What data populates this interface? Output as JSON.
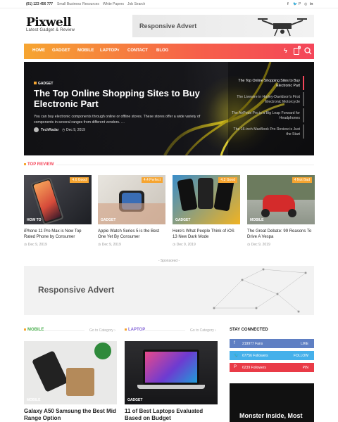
{
  "topbar": {
    "phone": "(01) 123 456 777",
    "links": [
      "Small Business",
      "Resources",
      "White Papers",
      "Job Search"
    ],
    "social_icons": [
      "facebook-icon",
      "twitter-icon",
      "pinterest-icon",
      "instagram-icon",
      "linkedin-icon"
    ]
  },
  "logo": {
    "name": "Pixwell",
    "tagline": "Latest Gadget & Review"
  },
  "advert_top": {
    "label": "Responsive Advert"
  },
  "nav": {
    "items": [
      "HOME",
      "GADGET",
      "MOBILE",
      "LAPTOP",
      "CONTACT",
      "BLOG"
    ],
    "laptop_chevron": "˅",
    "icons": [
      "lightning-icon",
      "bookmark-icon",
      "search-icon"
    ],
    "bookmark_count": "0"
  },
  "hero": {
    "category": "GADGET",
    "title": "The Top Online Shopping Sites to Buy Electronic Part",
    "description": "You can buy electronic components through online or offline stores. These stores offer a wide variety of components in several ranges from different vendors. …",
    "author": "TechRadar",
    "date": "Dec 9, 2019",
    "side_list": [
      "The Top Online Shopping Sites to Buy Electronic Part",
      "The Livewire in Harley-Davidson's First Electronic Motorcycle",
      "The AirPods Pro is a Big Leap Forward for Headphones",
      "The 16-inch MacBook Pro Review is Just the Start"
    ]
  },
  "top_review": {
    "title": "TOP REVIEW",
    "cards": [
      {
        "badge": "4.6 Good",
        "category": "HOW TO",
        "title": "iPhone 11 Pro Max is Now Top Rated Phone by Consumer",
        "date": "Dec 9, 2019"
      },
      {
        "badge": "4.4 Perfect",
        "category": "GADGET",
        "title": "Apple Watch Series 5 is the Best One Yet By Consumer",
        "date": "Dec 9, 2019"
      },
      {
        "badge": "4.2 Good",
        "category": "GADGET",
        "title": "Here's What People Think of iOS 13 New Dark Mode",
        "date": "Dec 9, 2019"
      },
      {
        "badge": "4 Not Bad",
        "category": "MOBILE",
        "title": "The Great Debate: 99 Reasons To Drive A Vespa",
        "date": "Dec 9, 2019"
      }
    ]
  },
  "sponsored_label": "- Sponsored -",
  "advert_mid": {
    "label": "Responsive Advert"
  },
  "mobile_block": {
    "title": "MOBILE",
    "goto": "Go to Category",
    "category": "MOBILE",
    "post_title": "Galaxy A50 Samsung the Best Mid Range Option"
  },
  "laptop_block": {
    "title": "LAPTOP",
    "goto": "Go to Category",
    "category": "GADGET",
    "post_title": "11 of Best Laptops Evaluated Based on Budget"
  },
  "stay_connected": {
    "title": "STAY CONNECTED",
    "items": [
      {
        "icon": "facebook-icon",
        "count": "219977 Fans",
        "action": "LIKE",
        "color": "#5f7fc3"
      },
      {
        "icon": "twitter-icon",
        "count": "67756 Followers",
        "action": "FOLLOW",
        "color": "#45b0ea"
      },
      {
        "icon": "pinterest-icon",
        "count": "6239 Followers",
        "action": "PIN",
        "color": "#e93b47"
      }
    ]
  },
  "dark_box": {
    "title": "Monster Inside, Most"
  },
  "colors": {
    "accent": "#f4465a",
    "orange": "#f6a531"
  }
}
